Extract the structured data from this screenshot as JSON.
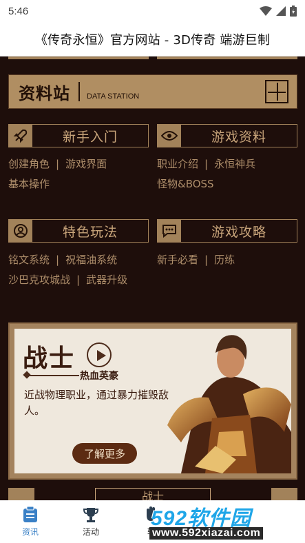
{
  "status": {
    "time": "5:46",
    "icons": [
      "wifi-icon",
      "signal-icon",
      "battery-icon"
    ]
  },
  "title": "《传奇永恒》官方网站 - 3D传奇 端游巨制",
  "section": {
    "title": "资料站",
    "subtitle": "DATA STATION"
  },
  "categories": [
    {
      "label": "新手入门",
      "icon": "rocket-icon",
      "links": [
        [
          "创建角色",
          "游戏界面"
        ],
        [
          "基本操作"
        ]
      ]
    },
    {
      "label": "游戏资料",
      "icon": "eye-icon",
      "links": [
        [
          "职业介绍",
          "永恒神兵"
        ],
        [
          "怪物&BOSS"
        ]
      ]
    },
    {
      "label": "特色玩法",
      "icon": "user-icon",
      "links": [
        [
          "铭文系统",
          "祝福油系统"
        ],
        [
          "沙巴克攻城战",
          "武器升级"
        ]
      ]
    },
    {
      "label": "游戏攻略",
      "icon": "chat-icon",
      "links": [
        [
          "新手必看",
          "历练"
        ],
        []
      ]
    }
  ],
  "hero": {
    "title": "战士",
    "subtitle": "热血英豪",
    "description": "近战物理职业，通过暴力摧毁敌人。",
    "button": "了解更多"
  },
  "peek_tab": "战士",
  "bottom_nav": [
    {
      "label": "资讯",
      "icon": "news-icon",
      "active": true
    },
    {
      "label": "活动",
      "icon": "trophy-icon",
      "active": false
    },
    {
      "label": "辅",
      "icon": "hand-icon",
      "active": false
    }
  ],
  "watermark": {
    "title": "592软件园",
    "url": "www.592xiazai.com"
  },
  "colors": {
    "background": "#1e0e0b",
    "gold": "#a2825a",
    "text_gold": "#c8a47a",
    "active_blue": "#3a80c6"
  }
}
